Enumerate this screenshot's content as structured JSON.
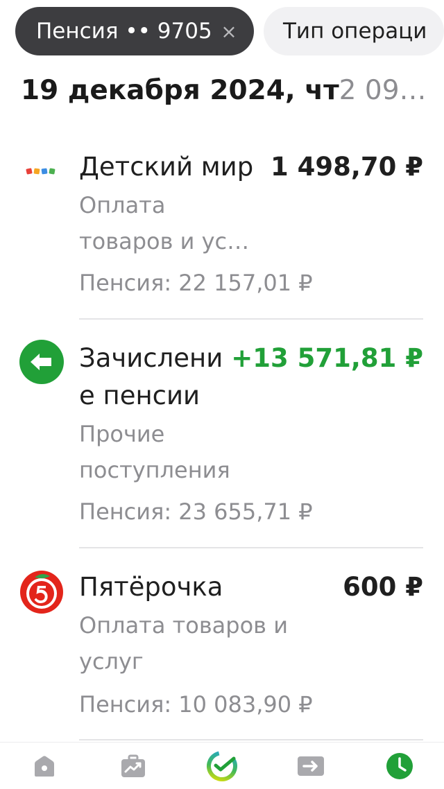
{
  "filters": {
    "active": {
      "label": "Пенсия •• 9705",
      "close_symbol": "×"
    },
    "next": {
      "label": "Тип операци"
    }
  },
  "day": {
    "date": "19 декабря 2024, чт",
    "total": "2 09…"
  },
  "transactions": [
    {
      "icon": "detsky-mir-logo",
      "title_lines": [
        "Детский мир"
      ],
      "amount": "1 498,70 ₽",
      "category_lines": [
        "Оплата",
        "товаров и ус…"
      ],
      "balance": "Пенсия: 22 157,01 ₽"
    },
    {
      "icon": "incoming-arrow-icon",
      "title_lines": [
        "Зачислени",
        "е пенсии"
      ],
      "amount": "+13 571,81 ₽",
      "category_lines": [
        "Прочие",
        "поступления"
      ],
      "balance": "Пенсия: 23 655,71 ₽"
    },
    {
      "icon": "pyaterochka-logo",
      "title_lines": [
        "Пятёрочка"
      ],
      "amount": "600 ₽",
      "category_lines": [
        "Оплата товаров и",
        "услуг"
      ],
      "balance": "Пенсия: 10 083,90 ₽"
    }
  ],
  "colors": {
    "credit": "#21a038",
    "secondary_text": "#8d8d91",
    "chip_active_bg": "#3d3d40",
    "nav_icon": "#a9a9ad",
    "nav_active": "#21a038"
  },
  "bottom_nav": [
    {
      "icon": "home-icon",
      "active": false
    },
    {
      "icon": "briefcase-chart-icon",
      "active": false
    },
    {
      "icon": "sber-logo-icon",
      "active": false
    },
    {
      "icon": "transfer-arrow-icon",
      "active": false
    },
    {
      "icon": "history-clock-icon",
      "active": true
    }
  ]
}
